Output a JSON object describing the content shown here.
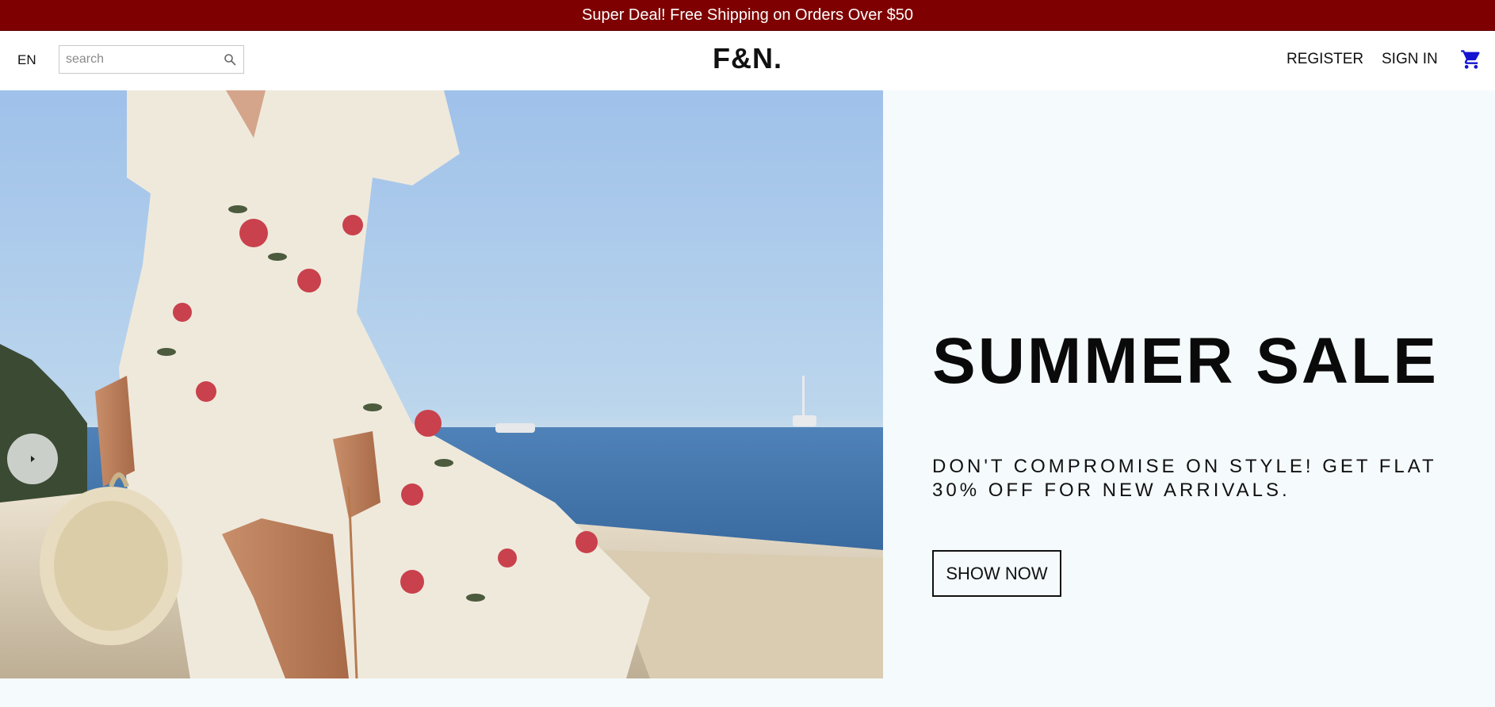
{
  "announcement": {
    "text": "Super Deal! Free Shipping on Orders Over $50"
  },
  "navbar": {
    "language": "EN",
    "search": {
      "placeholder": "search",
      "value": ""
    },
    "logo": "F&N.",
    "links": {
      "register": "REGISTER",
      "signin": "SIGN IN"
    },
    "icons": {
      "search": "search-icon",
      "cart": "shopping-cart-icon"
    }
  },
  "hero": {
    "title": "SUMMER SALE",
    "description": "DON'T COMPROMISE ON STYLE! GET FLAT 30% OFF FOR NEW ARRIVALS.",
    "cta": "SHOW NOW",
    "slider_icon": "play-arrow-icon"
  },
  "colors": {
    "announcement_bg": "#7e0000",
    "cart_icon": "#1414d0",
    "hero_bg": "#f5fafd"
  }
}
